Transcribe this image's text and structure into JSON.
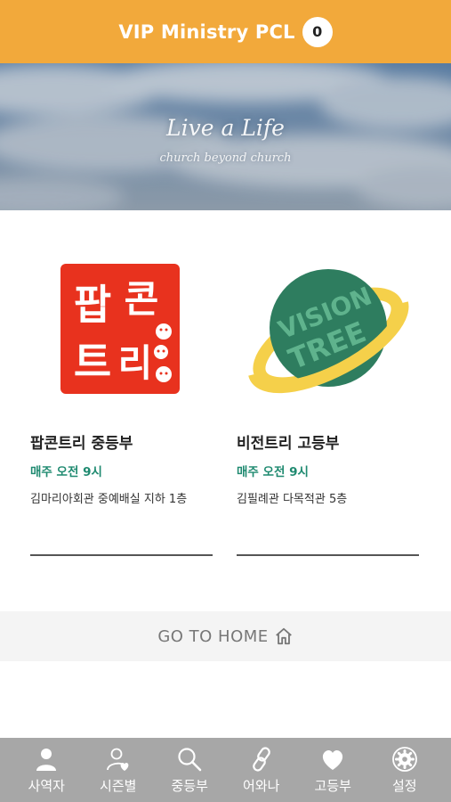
{
  "header": {
    "title": "VIP Ministry PCL",
    "badge_count": "0"
  },
  "banner": {
    "title": "Live a Life",
    "subtitle": "church beyond church"
  },
  "cards": [
    {
      "logo_text": [
        "팝",
        "콘",
        "트",
        "리"
      ],
      "name": "팝콘트리 중등부",
      "time": "매주 오전 9시",
      "place": "김마리아회관 중예배실 지하 1층"
    },
    {
      "logo_text": [
        "VISION",
        "TREE"
      ],
      "name": "비전트리 고등부",
      "time": "매주 오전 9시",
      "place": "김필례관 다목적관 5층"
    }
  ],
  "home_link": {
    "label": "GO TO HOME",
    "icon": "home-icon"
  },
  "bottom_nav": [
    {
      "label": "사역자",
      "icon": "person-icon"
    },
    {
      "label": "시즌별",
      "icon": "person-heart-icon"
    },
    {
      "label": "중등부",
      "icon": "search-icon"
    },
    {
      "label": "어와나",
      "icon": "link-icon"
    },
    {
      "label": "고등부",
      "icon": "heart-icon"
    },
    {
      "label": "설정",
      "icon": "gear-icon"
    }
  ],
  "colors": {
    "header": "#f2a93b",
    "accent_green": "#1f8a70",
    "nav_bg": "#a7a7a7",
    "logo_red": "#e8321e",
    "vision_green": "#2e7d5f",
    "vision_ring": "#f5d04a"
  }
}
